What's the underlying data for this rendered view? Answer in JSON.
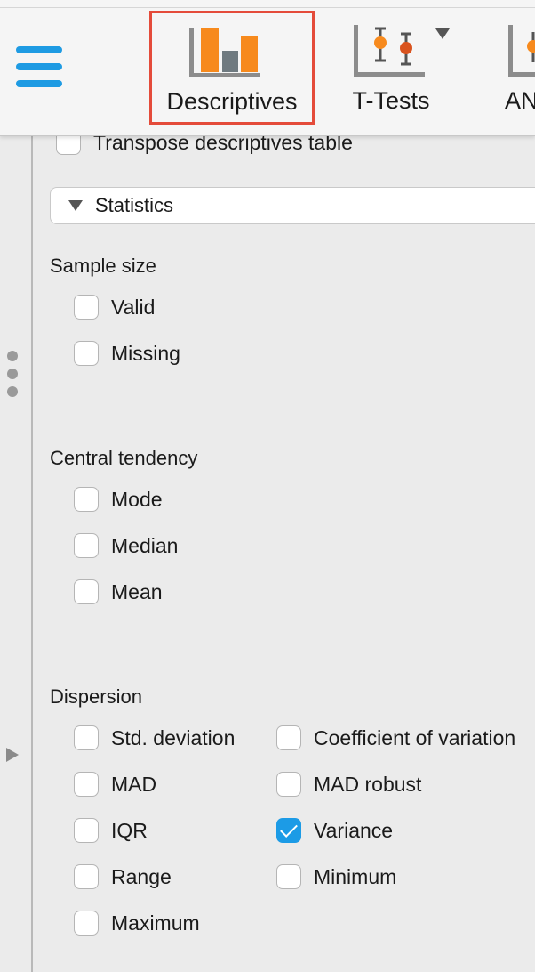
{
  "toolbar": {
    "modules": [
      {
        "label": "Descriptives",
        "icon": "descriptives-bar-chart-icon"
      },
      {
        "label": "T-Tests",
        "icon": "t-tests-error-bar-icon"
      },
      {
        "label": "AN",
        "icon": "anova-icon"
      }
    ],
    "colors": {
      "menu_blue": "#1e9be3",
      "selection_border": "#e44b3a",
      "bar_orange": "#f78a1d",
      "bar_gray": "#6f7a80"
    }
  },
  "options": {
    "transpose_label": "Transpose descriptives table",
    "statistics_section": "Statistics",
    "sample_size": {
      "heading": "Sample size",
      "items": [
        {
          "label": "Valid",
          "checked": false
        },
        {
          "label": "Missing",
          "checked": false
        }
      ]
    },
    "central_tendency": {
      "heading": "Central tendency",
      "items": [
        {
          "label": "Mode",
          "checked": false
        },
        {
          "label": "Median",
          "checked": false
        },
        {
          "label": "Mean",
          "checked": false
        }
      ]
    },
    "dispersion": {
      "heading": "Dispersion",
      "left": [
        {
          "label": "Std. deviation",
          "checked": false
        },
        {
          "label": "MAD",
          "checked": false
        },
        {
          "label": "IQR",
          "checked": false
        },
        {
          "label": "Range",
          "checked": false
        },
        {
          "label": "Maximum",
          "checked": false
        }
      ],
      "right": [
        {
          "label": "Coefficient of variation",
          "checked": false
        },
        {
          "label": "MAD robust",
          "checked": false
        },
        {
          "label": "Variance",
          "checked": true
        },
        {
          "label": "Minimum",
          "checked": false
        }
      ]
    }
  }
}
